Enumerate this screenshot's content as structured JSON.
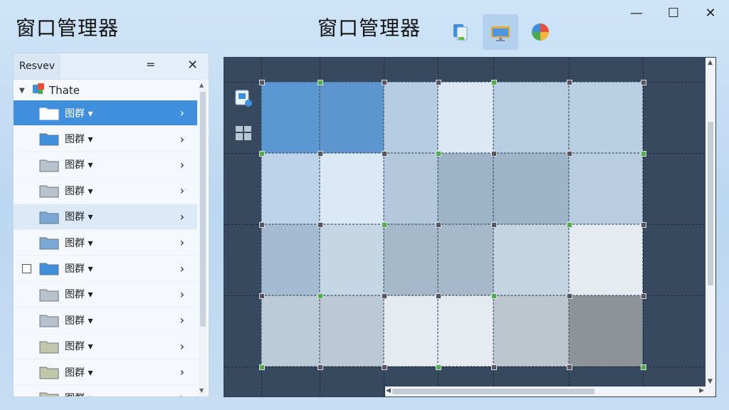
{
  "window": {
    "app_title": "窗口管理器",
    "center_title": "窗口管理器",
    "minimize": "—",
    "maximize": "☐",
    "close": "✕"
  },
  "toolbar": {
    "icons": [
      "file-copy-icon",
      "folder-monitor-icon",
      "color-wheel-icon"
    ]
  },
  "panel": {
    "tab_label": "Resvev",
    "menu_symbol": "=",
    "close_symbol": "✕",
    "root_label": "Thate",
    "items": [
      {
        "label": "图群 ▾",
        "state": "selected",
        "chev": "›"
      },
      {
        "label": "图群 ▾",
        "state": "normal",
        "chev": "›"
      },
      {
        "label": "图群 ▾",
        "state": "normal",
        "chev": "›"
      },
      {
        "label": "图群 ▾",
        "state": "normal",
        "chev": "›"
      },
      {
        "label": "图群 ▾",
        "state": "hover",
        "chev": "›"
      },
      {
        "label": "图群 ▾",
        "state": "normal",
        "chev": "›"
      },
      {
        "label": "图群 ▾",
        "state": "checkbox",
        "chev": "›"
      },
      {
        "label": "图群 ▾",
        "state": "normal",
        "chev": "›"
      },
      {
        "label": "图群 ▾",
        "state": "normal",
        "chev": "›"
      },
      {
        "label": "图群 ▾",
        "state": "normal",
        "chev": "›"
      },
      {
        "label": "图群 ▾",
        "state": "normal",
        "chev": "›"
      },
      {
        "label": "图群 ▾",
        "state": "normal",
        "chev": "›"
      }
    ]
  },
  "colors": {
    "accent": "#3f8fdd",
    "canvas_bg": "#37495e",
    "cells": [
      [
        "#5b97d3",
        "#5d95cf",
        "#b5cce3",
        "#dce9f5",
        "#b7cde2",
        "#b8cfe4"
      ],
      [
        "#bcd3ea",
        "#dbe9f6",
        "#b3c8dc",
        "#9cb3c8",
        "#9eb4c9",
        "#b9cde0"
      ],
      [
        "#a4bbd1",
        "#c5d6e5",
        "#a6b9cb",
        "#a6b9cb",
        "#c4d4e2",
        "#e5ebf1"
      ],
      [
        "#bccbd8",
        "#bac9d5",
        "#e5ebf0",
        "#e5ebf0",
        "#bdc6cf",
        "#8e9399"
      ]
    ]
  }
}
